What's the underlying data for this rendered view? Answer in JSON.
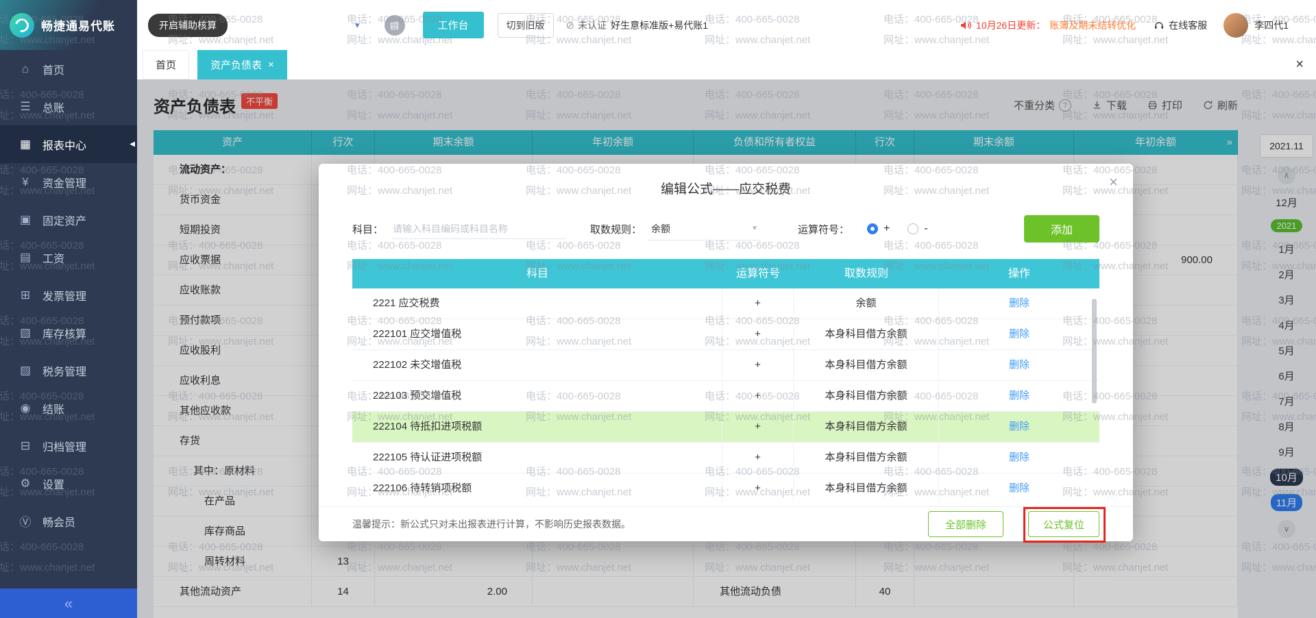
{
  "colors": {
    "teal": "#34c0cf",
    "green": "#6cc228",
    "link": "#3f9bfa",
    "red": "#f5483d",
    "highlight_row": "#d9f5c2",
    "selected_blue": "#2f7df0",
    "sidebar_bg": "#2d3a51",
    "annotation_red": "#e8231d"
  },
  "icons": {
    "close": "×",
    "caret_down": "▾",
    "select_caret": "▼",
    "chevron_up": "∧",
    "chevron_down": "∨",
    "double_arrow": "»",
    "collapse": "«",
    "uncertified": "⊘",
    "app": "▤",
    "active_arrow": "◀",
    "help": "?"
  },
  "watermark": {
    "line1": "电话：400-665-0028",
    "line2": "网址：www.chanjet.net"
  },
  "logo": {
    "text": "畅捷通易代账"
  },
  "sidebar": {
    "items": [
      {
        "icon": "⌂",
        "label": "首页",
        "name": "home"
      },
      {
        "icon": "☰",
        "label": "总账",
        "name": "ledger"
      },
      {
        "icon": "▦",
        "label": "报表中心",
        "name": "reports",
        "active": true
      },
      {
        "icon": "¥",
        "label": "资金管理",
        "name": "funds"
      },
      {
        "icon": "▣",
        "label": "固定资产",
        "name": "fixed-assets"
      },
      {
        "icon": "▤",
        "label": "工资",
        "name": "salary"
      },
      {
        "icon": "⊞",
        "label": "发票管理",
        "name": "invoices"
      },
      {
        "icon": "▧",
        "label": "库存核算",
        "name": "inventory"
      },
      {
        "icon": "▨",
        "label": "税务管理",
        "name": "tax"
      },
      {
        "icon": "◉",
        "label": "结账",
        "name": "closing"
      },
      {
        "icon": "⊟",
        "label": "归档管理",
        "name": "archive"
      },
      {
        "icon": "⚙",
        "label": "设置",
        "name": "settings"
      },
      {
        "icon": "Ⓥ",
        "label": "畅会员",
        "name": "member"
      }
    ]
  },
  "topbar": {
    "assist_button": "开启辅助核算",
    "workbench_button": "工作台",
    "switch_old_button": "切到旧版",
    "uncertified_badge": "未认证",
    "product_name": "好生意标准版+易代账1",
    "announcement_prefix": "10月26日更新：",
    "announcement_text": "账簿及期未结转优化",
    "online_service": "在线客服",
    "username": "李四代1"
  },
  "tabs": [
    {
      "label": "首页",
      "name": "home"
    },
    {
      "label": "资产负债表",
      "name": "balance-sheet",
      "active": true,
      "closable": true
    }
  ],
  "page": {
    "title": "资产负债表",
    "balance_badge": "不平衡",
    "toolbar": {
      "reclass": "不重分类",
      "download": "下载",
      "print": "打印",
      "refresh": "刷新"
    }
  },
  "balance_table": {
    "headers": [
      "资产",
      "行次",
      "期末余额",
      "年初余额",
      "负债和所有者权益",
      "行次",
      "期末余额",
      "年初余额"
    ],
    "rows": [
      {
        "asset": "流动资产：",
        "cls": "bold"
      },
      {
        "asset": "货币资金"
      },
      {
        "asset": "短期投资"
      },
      {
        "asset": "应收票据",
        "begin2": "900.00"
      },
      {
        "asset": "应收账款"
      },
      {
        "asset": "预付款项"
      },
      {
        "asset": "应收股利"
      },
      {
        "asset": "应收利息"
      },
      {
        "asset": "其他应收款"
      },
      {
        "asset": "存货"
      },
      {
        "asset": "其中：原材料",
        "cls": "indent"
      },
      {
        "asset": "在产品",
        "cls": "indent2"
      },
      {
        "asset": "库存商品",
        "cls": "indent2"
      },
      {
        "asset": "周转材料",
        "cls": "indent2",
        "line": "13"
      },
      {
        "asset": "其他流动资产",
        "line": "14",
        "end": "2.00",
        "liability": "其他流动负债",
        "line2": "40"
      }
    ]
  },
  "period_panel": {
    "current": "2021.11",
    "items": [
      {
        "label": "12月"
      },
      {
        "label": "2021",
        "cls": "year"
      },
      {
        "label": "1月"
      },
      {
        "label": "2月"
      },
      {
        "label": "3月"
      },
      {
        "label": "4月"
      },
      {
        "label": "5月"
      },
      {
        "label": "6月"
      },
      {
        "label": "7月"
      },
      {
        "label": "8月"
      },
      {
        "label": "9月"
      },
      {
        "label": "10月",
        "cls": "dark"
      },
      {
        "label": "11月",
        "cls": "selected"
      }
    ]
  },
  "modal": {
    "title": "编辑公式——应交税费",
    "subject_label": "科目：",
    "subject_placeholder": "请输入科目编码或科目名称",
    "rule_label": "取数规则：",
    "rule_value": "余额",
    "operator_label": "运算符号：",
    "op_plus": "+",
    "op_minus": "-",
    "add_button": "添加",
    "table": {
      "headers": [
        "科目",
        "运算符号",
        "取数规则",
        "操作"
      ],
      "rows": [
        {
          "subject": "2221 应交税费",
          "op": "+",
          "rule": "余额",
          "action": "删除"
        },
        {
          "subject": "222101 应交增值税",
          "op": "+",
          "rule": "本身科目借方余额",
          "action": "删除"
        },
        {
          "subject": "222102 未交增值税",
          "op": "+",
          "rule": "本身科目借方余额",
          "action": "删除"
        },
        {
          "subject": "222103 预交增值税",
          "op": "+",
          "rule": "本身科目借方余额",
          "action": "删除"
        },
        {
          "subject": "222104 待抵扣进项税额",
          "op": "+",
          "rule": "本身科目借方余额",
          "action": "删除",
          "cls": "highlight"
        },
        {
          "subject": "222105 待认证进项税额",
          "op": "+",
          "rule": "本身科目借方余额",
          "action": "删除"
        },
        {
          "subject": "222106 待转销项税额",
          "op": "+",
          "rule": "本身科目借方余额",
          "action": "删除"
        }
      ]
    },
    "tip": "温馨提示：新公式只对未出报表进行计算，不影响历史报表数据。",
    "delete_all_button": "全部删除",
    "reset_button": "公式复位"
  }
}
